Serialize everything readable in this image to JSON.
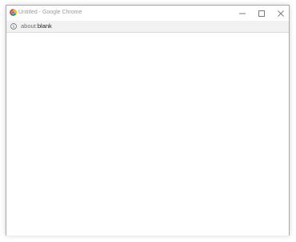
{
  "window": {
    "title": "Untitled - Google Chrome"
  },
  "titlebar": {
    "minimize_icon": "minimize-icon",
    "maximize_icon": "maximize-icon",
    "close_icon": "close-icon"
  },
  "toolbar": {
    "url_scheme": "about:",
    "url_path": "blank",
    "info_icon": "info-icon"
  },
  "colors": {
    "titlebar_bg": "#ffffff",
    "toolbar_bg": "#f2f2f2",
    "window_border": "#a9a9a9",
    "content_bg": "#ffffff"
  }
}
